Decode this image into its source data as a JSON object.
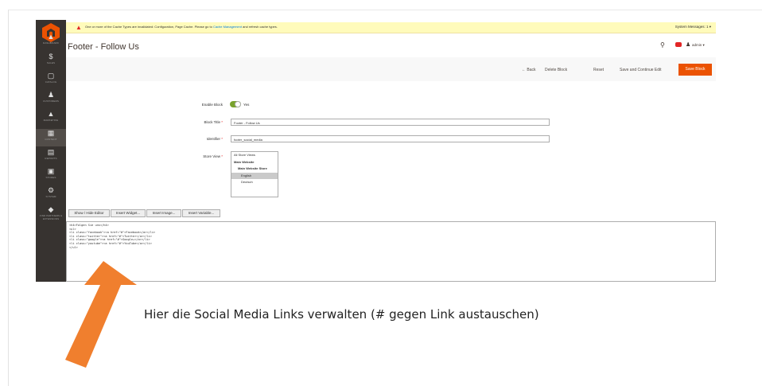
{
  "notice": {
    "message": "One or more of the Cache Types are invalidated: Configuration, Page Cache. Please go to",
    "link": "Cache Management",
    "message_end": "and refresh cache types.",
    "system_messages": "System Messages: 1 ▾"
  },
  "header": {
    "title": "Footer - Follow Us",
    "user": "admin ▾"
  },
  "sidebar": {
    "items": [
      {
        "label": "DASHBOARD",
        "icon": "dashboard-icon"
      },
      {
        "label": "SALES",
        "icon": "dollar-icon"
      },
      {
        "label": "CATALOG",
        "icon": "box-icon"
      },
      {
        "label": "CUSTOMERS",
        "icon": "person-icon"
      },
      {
        "label": "MARKETING",
        "icon": "megaphone-icon"
      },
      {
        "label": "CONTENT",
        "icon": "layout-icon"
      },
      {
        "label": "REPORTS",
        "icon": "bar-chart-icon"
      },
      {
        "label": "STORES",
        "icon": "store-icon"
      },
      {
        "label": "SYSTEM",
        "icon": "gear-icon"
      },
      {
        "label": "FIND PARTNERS & EXTENSIONS",
        "icon": "puzzle-icon"
      }
    ]
  },
  "actions": {
    "back": "← Back",
    "delete": "Delete Block",
    "reset": "Reset",
    "save_continue": "Save and Continue Edit",
    "save": "Save Block"
  },
  "form": {
    "enable_label": "Enable Block",
    "enable_value": "Yes",
    "title_label": "Block Title",
    "title_value": "Footer - Follow Us",
    "identifier_label": "Identifier",
    "identifier_value": "footer_social_media",
    "store_label": "Store View",
    "store_options": [
      {
        "label": "All Store Views",
        "bold": false,
        "selected": false
      },
      {
        "label": "Main Website",
        "bold": true,
        "selected": false
      },
      {
        "label": "Main Website Store",
        "bold": true,
        "selected": false
      },
      {
        "label": "English",
        "bold": false,
        "selected": true
      },
      {
        "label": "Deutsch",
        "bold": false,
        "selected": false
      }
    ]
  },
  "editor": {
    "show_hide": "Show / Hide Editor",
    "insert_widget": "Insert Widget...",
    "insert_image": "Insert Image...",
    "insert_variable": "Insert Variable...",
    "code": "<h4>Folgen Sie uns</h4>\n<ul>\n<li class=\"facebook\"><a href=\"#\">Facebook</a></li>\n<li class=\"twitter\"><a href=\"#\">Twitter</a></li>\n<li class=\"google\"><a href=\"#\">Google+</a></li>\n<li class=\"youtube\"><a href=\"#\">YouTube</a></li>\n</ul>"
  },
  "annotation": {
    "caption": "Hier die Social Media Links verwalten (# gegen Link austauschen)",
    "arrow_color": "#f07f2e"
  },
  "colors": {
    "accent": "#eb5202",
    "sidebar": "#373330",
    "notice_bg": "#fffbbb"
  }
}
